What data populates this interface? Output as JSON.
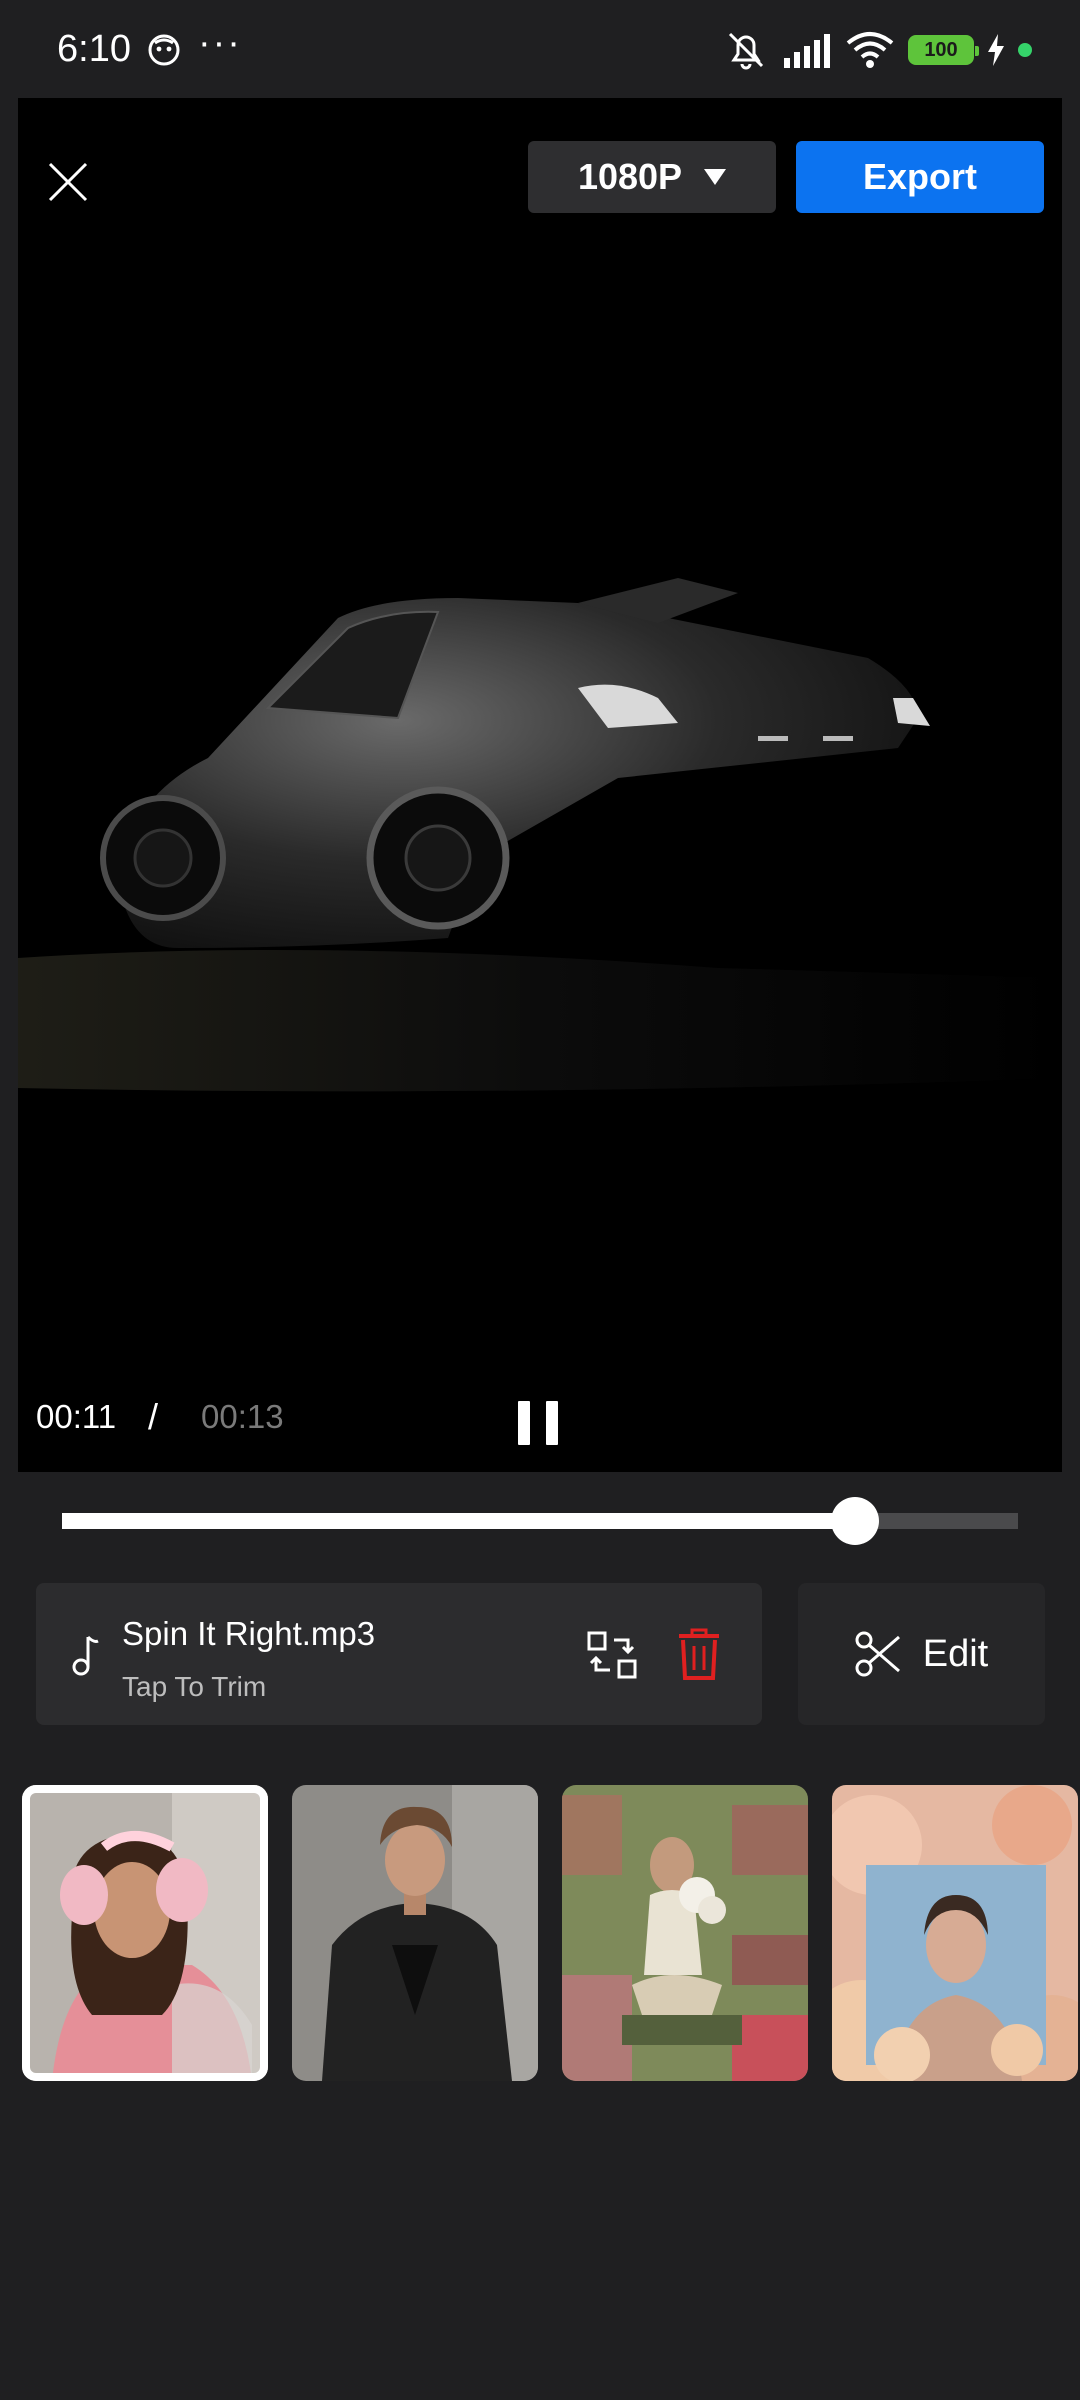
{
  "status_bar": {
    "time": "6:10",
    "dots": "···",
    "battery": "100"
  },
  "preview": {
    "resolution": "1080P",
    "export_label": "Export",
    "time_current": "00:11",
    "time_separator": "/",
    "time_total": "00:13"
  },
  "progress": {
    "fraction": 0.83
  },
  "music": {
    "title": "Spin It Right.mp3",
    "subtitle": "Tap To Trim"
  },
  "edit": {
    "label": "Edit"
  },
  "thumbnails": [
    {
      "name": "thumb-pink-hoodie",
      "selected": true
    },
    {
      "name": "thumb-black-blazer",
      "selected": false
    },
    {
      "name": "thumb-flowers-room",
      "selected": false
    },
    {
      "name": "thumb-flower-portrait",
      "selected": false
    }
  ],
  "colors": {
    "accent": "#0c73f0",
    "trash": "#e02020",
    "background": "#1f1f21"
  }
}
